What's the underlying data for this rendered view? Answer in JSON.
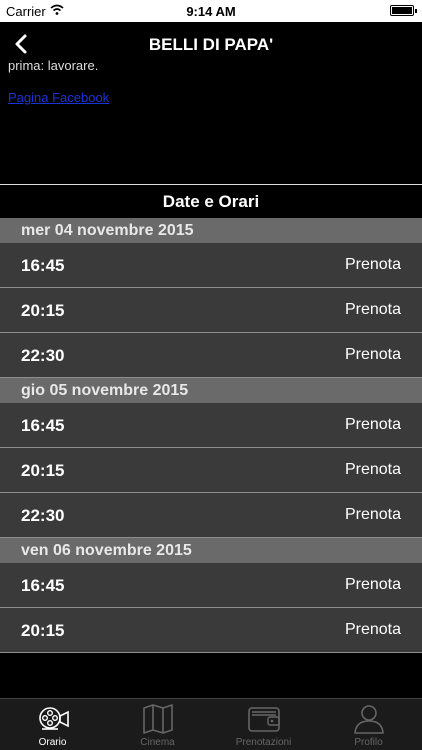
{
  "status": {
    "carrier": "Carrier",
    "time": "9:14 AM"
  },
  "nav": {
    "title": "BELLI DI PAPA'"
  },
  "description": "prima: lavorare.",
  "facebook_link": "Pagina Facebook",
  "section_title": "Date e Orari",
  "days": [
    {
      "label": "mer 04 novembre 2015",
      "times": [
        "16:45",
        "20:15",
        "22:30"
      ]
    },
    {
      "label": "gio 05 novembre 2015",
      "times": [
        "16:45",
        "20:15",
        "22:30"
      ]
    },
    {
      "label": "ven 06 novembre 2015",
      "times": [
        "16:45",
        "20:15"
      ]
    }
  ],
  "book_label": "Prenota",
  "tabs": [
    {
      "label": "Orario",
      "icon": "film-camera-icon",
      "active": true
    },
    {
      "label": "Cinema",
      "icon": "map-icon",
      "active": false
    },
    {
      "label": "Prenotazioni",
      "icon": "wallet-icon",
      "active": false
    },
    {
      "label": "Profilo",
      "icon": "user-icon",
      "active": false
    }
  ]
}
